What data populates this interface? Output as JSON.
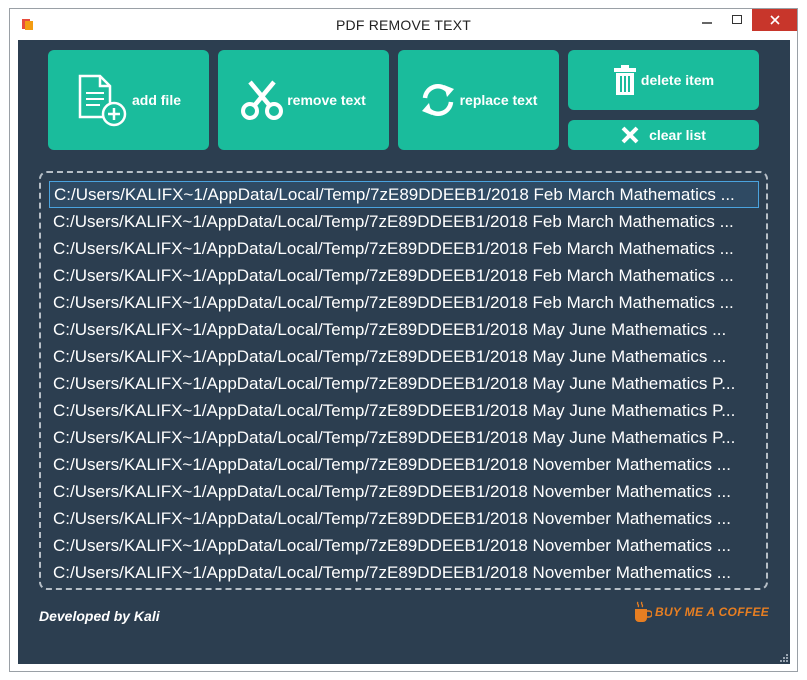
{
  "window": {
    "title": "PDF REMOVE TEXT"
  },
  "titlebar_icons": {
    "minimize": "minimize-icon",
    "maximize": "maximize-icon",
    "close": "close-icon"
  },
  "toolbar": {
    "add_file": "add file",
    "remove_text": "remove text",
    "replace_text": "replace text",
    "delete_item": "delete item",
    "clear_list": "clear list"
  },
  "files": [
    "C:/Users/KALIFX~1/AppData/Local/Temp/7zE89DDEEB1/2018 Feb March Mathematics ...",
    "C:/Users/KALIFX~1/AppData/Local/Temp/7zE89DDEEB1/2018 Feb March Mathematics ...",
    "C:/Users/KALIFX~1/AppData/Local/Temp/7zE89DDEEB1/2018 Feb March Mathematics ...",
    "C:/Users/KALIFX~1/AppData/Local/Temp/7zE89DDEEB1/2018 Feb March Mathematics ...",
    "C:/Users/KALIFX~1/AppData/Local/Temp/7zE89DDEEB1/2018 Feb March Mathematics ...",
    "C:/Users/KALIFX~1/AppData/Local/Temp/7zE89DDEEB1/2018 May June Mathematics ...",
    "C:/Users/KALIFX~1/AppData/Local/Temp/7zE89DDEEB1/2018 May June Mathematics ...",
    "C:/Users/KALIFX~1/AppData/Local/Temp/7zE89DDEEB1/2018 May June Mathematics P...",
    "C:/Users/KALIFX~1/AppData/Local/Temp/7zE89DDEEB1/2018 May June Mathematics P...",
    "C:/Users/KALIFX~1/AppData/Local/Temp/7zE89DDEEB1/2018 May June Mathematics P...",
    "C:/Users/KALIFX~1/AppData/Local/Temp/7zE89DDEEB1/2018 November Mathematics ...",
    "C:/Users/KALIFX~1/AppData/Local/Temp/7zE89DDEEB1/2018 November Mathematics ...",
    "C:/Users/KALIFX~1/AppData/Local/Temp/7zE89DDEEB1/2018 November Mathematics ...",
    "C:/Users/KALIFX~1/AppData/Local/Temp/7zE89DDEEB1/2018 November Mathematics ...",
    "C:/Users/KALIFX~1/AppData/Local/Temp/7zE89DDEEB1/2018 November Mathematics ..."
  ],
  "selected_index": 0,
  "footer": {
    "developer": "Developed by Kali",
    "coffee": "BUY ME A COFFEE"
  },
  "colors": {
    "background": "#2c3e50",
    "accent": "#1abc9c",
    "coffee": "#e67e22",
    "close": "#c8362b"
  }
}
